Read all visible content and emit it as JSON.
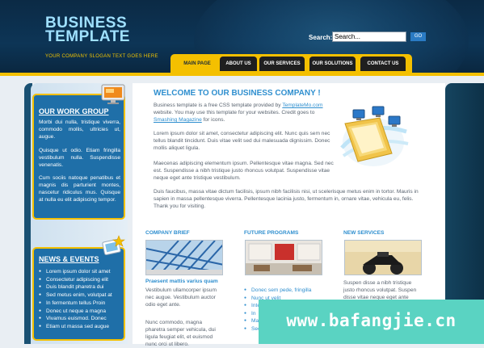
{
  "header": {
    "brand_line1": "BUSINESS",
    "brand_line2": "TEMPLATE",
    "slogan": "YOUR COMPANY SLOGAN TEXT GOES HERE",
    "search_label": "Search:",
    "search_value": "Search...",
    "search_button": "GO"
  },
  "nav": {
    "tabs": [
      {
        "label": "MAIN PAGE",
        "active": true
      },
      {
        "label": "ABOUT US",
        "active": false
      },
      {
        "label": "OUR SERVICES",
        "active": false
      },
      {
        "label": "OUR SOLUTIONS",
        "active": false
      },
      {
        "label": "CONTACT US",
        "active": false
      }
    ]
  },
  "sidebar": {
    "work_group": {
      "title": "OUR WORK GROUP",
      "paragraphs": [
        "Morbi dui nulla, tristique viverra, commodo mollis, ultricies ut, augue.",
        "Quisque ut odio. Etiam fringilla vestibulum nulla. Suspendisse venenatis.",
        "Cum sociis natoque penatibus et magnis dis parturient montes, nascetur ridiculus mus. Quisque at nulla eu elit adipiscing tempor."
      ]
    },
    "news": {
      "title": "NEWS & EVENTS",
      "items": [
        "Lorem ipsum dolor sit amet",
        "Consectetur adipiscing elit",
        "Duis blandit pharetra dui",
        "Sed metus enim, volutpat at",
        "In fermentum tellus Proin",
        "Donec ut neque a magna",
        "Vivamus euismod. Donec",
        "Etiam ut massa sed augue"
      ]
    }
  },
  "main": {
    "welcome_title": "WELCOME TO OUR BUSINESS COMPANY !",
    "intro_1": "Business template is a free CSS template provided by",
    "intro_link_1": "TemplateMo.com",
    "intro_2": "website. You may use this template for your websites. Credit goes to",
    "intro_link_2": "Smashing Magazine",
    "intro_3": "for icons.",
    "para_2": "Lorem ipsum dolor sit amet, consectetur adipiscing elit. Nunc quis sem nec tellus blandit tincidunt. Duis vitae velit sed dui malesuada dignissim. Donec mollis aliquet ligula.",
    "para_3": "Maecenas adipiscing elementum ipsum. Pellentesque vitae magna. Sed nec est. Suspendisse a nibh tristique justo rhoncus volutpat. Suspendisse vitae neque eget ante tristique vestibulum.",
    "para_4": "Duis faucibus, massa vitae dictum facilisis, ipsum nibh facilisis nisi, ut scelerisque metus enim in tortor. Mauris in sapien in massa pellentesque viverra. Pellentesque lacinia justo, fermentum in, ornare vitae, vehicula eu, felis. Thank you for visiting."
  },
  "columns": {
    "brief": {
      "title": "COMPANY BRIEF",
      "subtitle": "Praesent mattis varius quam",
      "text_1": "Vestibulum ullamcorper ipsum nec augue. Vestibulum auctor odio eget ante.",
      "text_2": "Nunc commodo, magna pharetra semper vehicula, dui ligula feugiat elit, et euismod nunc orci ut libero."
    },
    "programs": {
      "title": "FUTURE PROGRAMS",
      "items": [
        "Donec sem pede, fringilla",
        "Nunc ut velit",
        "Integer",
        "In",
        "Mauris",
        "Sed"
      ]
    },
    "services": {
      "title": "NEW SERVICES",
      "text": "Suspen disse a nibh tristique justo rhoncus volutpat. Suspen disse vitae neque eget ante"
    }
  },
  "watermark": "www.bafangjie.cn",
  "colors": {
    "accent_blue": "#2f8fcf",
    "nav_yellow": "#f4c000",
    "header_dark": "#0b2a45",
    "sidebar_blue": "#1f6fa8"
  }
}
